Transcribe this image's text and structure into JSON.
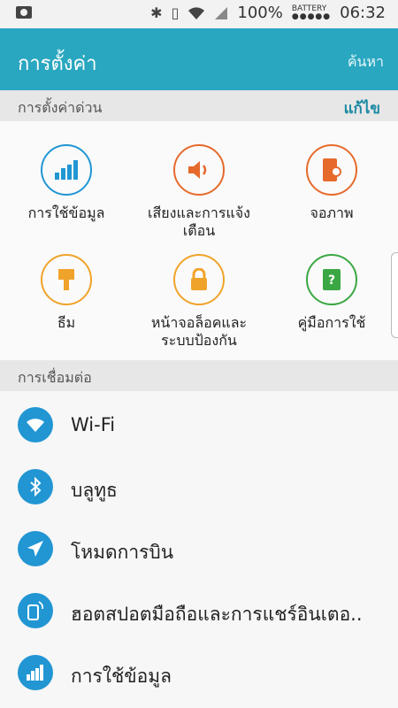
{
  "status_bar": {
    "battery_percent": "100%",
    "battery_label": "BATTERY",
    "time": "06:32",
    "icons": [
      "notification-icon",
      "bluetooth-icon",
      "vibrate-icon",
      "wifi-icon",
      "signal-icon"
    ]
  },
  "app_bar": {
    "title": "การตั้งค่า",
    "search_label": "ค้นหา"
  },
  "quick_settings": {
    "header": "การตั้งค่าด่วน",
    "edit_label": "แก้ไข",
    "tiles": [
      {
        "label": "การใช้ข้อมูล",
        "icon": "data-usage-icon",
        "color": "#2196d3"
      },
      {
        "label": "เสียงและการแจ้งเตือน",
        "icon": "sound-icon",
        "color": "#e66a2c"
      },
      {
        "label": "จอภาพ",
        "icon": "display-icon",
        "color": "#e66a2c"
      },
      {
        "label": "ธีม",
        "icon": "theme-icon",
        "color": "#f0a32a"
      },
      {
        "label": "หน้าจอล็อคและระบบป้องกัน",
        "icon": "lock-icon",
        "color": "#f0a32a"
      },
      {
        "label": "คู่มือการใช้",
        "icon": "user-manual-icon",
        "color": "#3aa743"
      }
    ]
  },
  "connections": {
    "header": "การเชื่อมต่อ",
    "items": [
      {
        "label": "Wi-Fi",
        "icon": "wifi-icon"
      },
      {
        "label": "บลูทูธ",
        "icon": "bluetooth-icon"
      },
      {
        "label": "โหมดการบิน",
        "icon": "airplane-icon"
      },
      {
        "label": "ฮอตสปอตมือถือและการแชร์อินเตอ..",
        "icon": "hotspot-icon"
      },
      {
        "label": "การใช้ข้อมูล",
        "icon": "data-usage-icon"
      }
    ]
  },
  "colors": {
    "app_bar": "#2aa7c0",
    "accent": "#1b8aa3",
    "list_icon": "#2196d3"
  }
}
